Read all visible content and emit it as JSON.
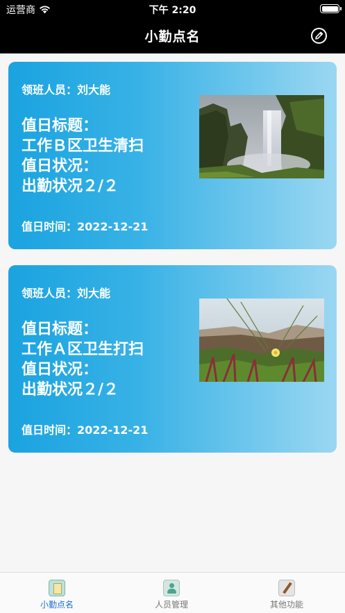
{
  "status_bar": {
    "carrier": "运营商",
    "time": "下午 2:20"
  },
  "nav": {
    "title": "小勤点名",
    "edit_icon": "edit-icon"
  },
  "cards": [
    {
      "leader": "领班人员：刘大能",
      "title_label": "值日标题：",
      "title_value": "工作Ｂ区卫生清扫",
      "status_label": "值日状况：",
      "status_value": "出勤状况２/２",
      "date": "值日时间：2022-12-21",
      "photo": "waterfall-photo"
    },
    {
      "leader": "领班人员：刘大能",
      "title_label": "值日标题：",
      "title_value": "工作Ａ区卫生打扫",
      "status_label": "值日状况：",
      "status_value": "出勤状况２/２",
      "date": "值日时间：2022-12-21",
      "photo": "grass-flower-photo"
    }
  ],
  "tabbar": {
    "items": [
      {
        "label": "小勤点名",
        "icon": "notebook-icon",
        "active": true
      },
      {
        "label": "人员管理",
        "icon": "person-icon",
        "active": false
      },
      {
        "label": "其他功能",
        "icon": "brush-icon",
        "active": false
      }
    ]
  },
  "colors": {
    "card_gradient_start": "#1aa3e0",
    "card_gradient_end": "#9bd7f2",
    "active_tab": "#1b6fd8",
    "nav_background": "#000000"
  }
}
